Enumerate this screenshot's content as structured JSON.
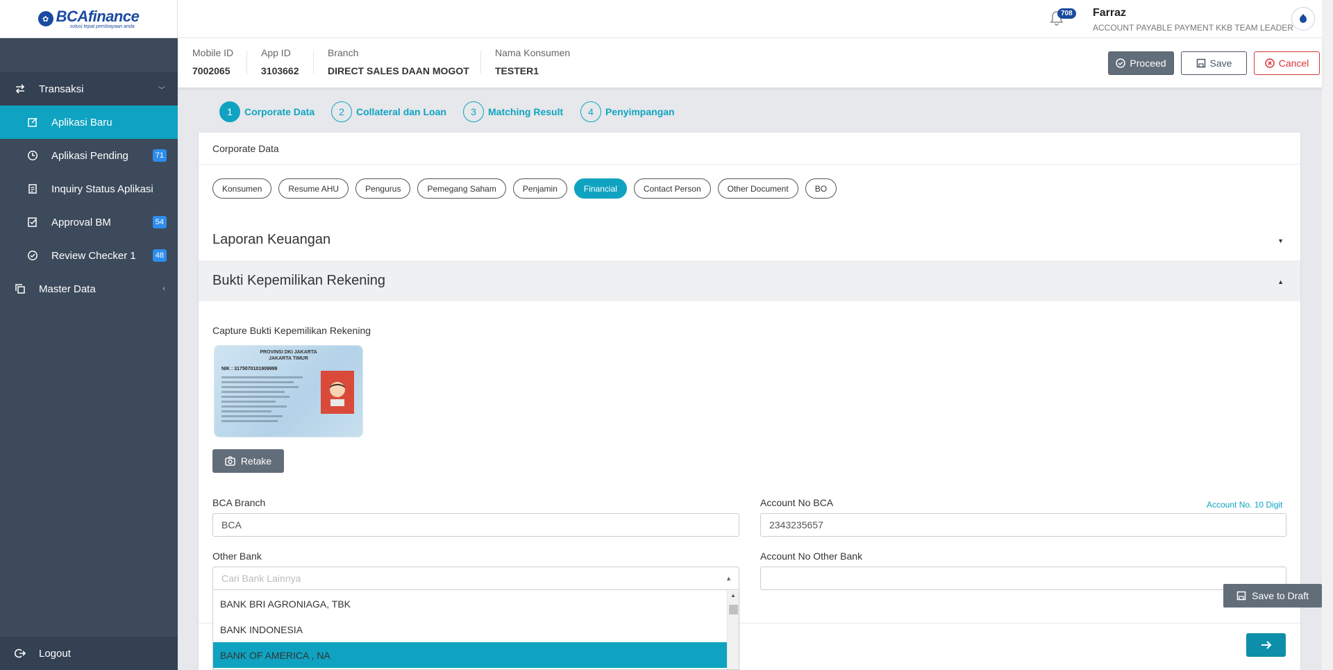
{
  "brand": {
    "logo_main": "BCAfinance",
    "logo_sub": "solusi tepat pembiayaan anda"
  },
  "sidebar": {
    "groups": [
      {
        "label": "Transaksi"
      },
      {
        "label": "Master Data"
      }
    ],
    "items": [
      {
        "label": "Aplikasi Baru",
        "badge": ""
      },
      {
        "label": "Aplikasi Pending",
        "badge": "71"
      },
      {
        "label": "Inquiry Status Aplikasi",
        "badge": ""
      },
      {
        "label": "Approval BM",
        "badge": "54"
      },
      {
        "label": "Review Checker 1",
        "badge": "48"
      }
    ],
    "logout": "Logout"
  },
  "topbar": {
    "notifications": "708",
    "user_name": "Farraz",
    "user_role": "ACCOUNT PAYABLE PAYMENT KKB TEAM LEADER"
  },
  "infobar": {
    "mobile_id_label": "Mobile ID",
    "mobile_id": "7002065",
    "app_id_label": "App ID",
    "app_id": "3103662",
    "branch_label": "Branch",
    "branch": "DIRECT SALES DAAN MOGOT",
    "nama_label": "Nama Konsumen",
    "nama": "TESTER1",
    "proceed": "Proceed",
    "save": "Save",
    "cancel": "Cancel"
  },
  "steps": [
    {
      "num": "1",
      "label": "Corporate Data"
    },
    {
      "num": "2",
      "label": "Collateral dan Loan"
    },
    {
      "num": "3",
      "label": "Matching Result"
    },
    {
      "num": "4",
      "label": "Penyimpangan"
    }
  ],
  "card": {
    "title": "Corporate Data",
    "tabs": [
      "Konsumen",
      "Resume AHU",
      "Pengurus",
      "Pemegang Saham",
      "Penjamin",
      "Financial",
      "Contact Person",
      "Other Document",
      "BO"
    ],
    "active_tab": "Financial",
    "section1": "Laporan Keuangan",
    "section2": "Bukti Kepemilikan Rekening",
    "capture_label": "Capture Bukti Kepemilikan Rekening",
    "ktp": {
      "line1": "PROVINSI DKI JAKARTA",
      "line2": "JAKARTA TIMUR",
      "nik": "NIK : 3175070101909999"
    },
    "retake": "Retake",
    "bca_branch_label": "BCA Branch",
    "bca_branch_value": "BCA",
    "account_no_bca_label": "Account No BCA",
    "account_no_hint": "Account No. 10 Digit",
    "account_no_bca_value": "2343235657",
    "other_bank_label": "Other Bank",
    "other_bank_placeholder": "Cari Bank Lainnya",
    "account_no_other_label": "Account No Other Bank",
    "account_no_other_value": "",
    "bank_options": [
      "BANK BRI AGRONIAGA, TBK",
      "BANK INDONESIA",
      "BANK OF AMERICA , NA"
    ],
    "selected_bank_option": "BANK OF AMERICA , NA",
    "save_draft": "Save to Draft"
  },
  "colors": {
    "accent": "#0fa3c1",
    "sidebar": "#3c4a5b",
    "danger": "#d9353a",
    "brand": "#1a4aa0"
  }
}
